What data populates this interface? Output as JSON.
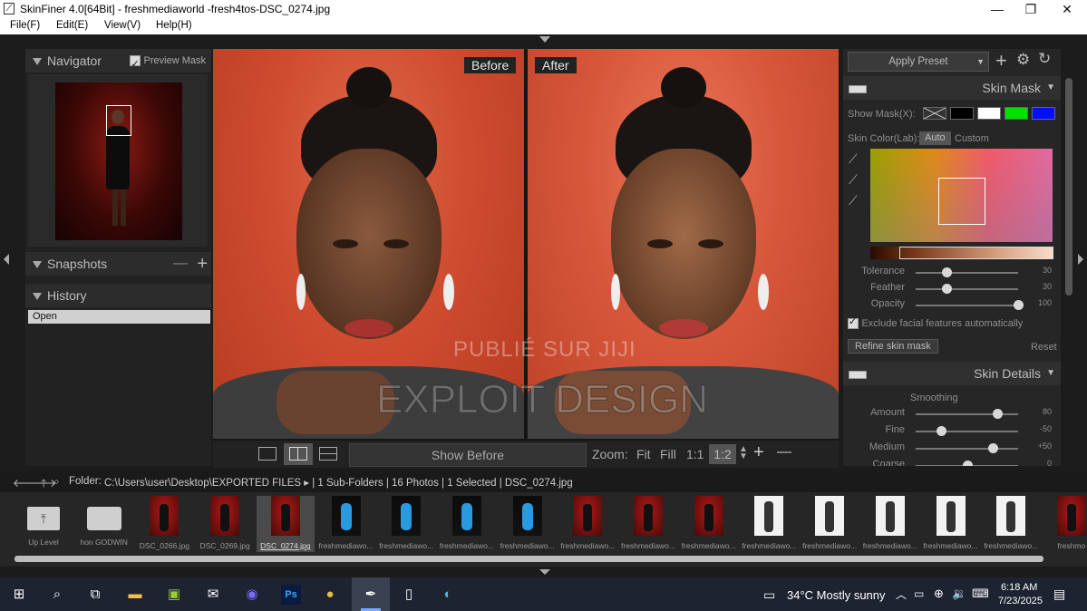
{
  "window": {
    "title": "SkinFiner 4.0[64Bit] - freshmediaworld -fresh4tos-DSC_0274.jpg",
    "controls": {
      "minimize": "—",
      "maximize": "❐",
      "close": "✕"
    }
  },
  "menu": [
    "File(F)",
    "Edit(E)",
    "View(V)",
    "Help(H)"
  ],
  "left": {
    "navigator": {
      "title": "Navigator",
      "preview_mask_label": "Preview Mask",
      "preview_mask_checked": true
    },
    "snapshots": {
      "title": "Snapshots",
      "minus": "—",
      "plus": "+"
    },
    "history": {
      "title": "History",
      "items": [
        "Open"
      ]
    }
  },
  "viewer": {
    "before_label": "Before",
    "after_label": "After",
    "watermark_top": "PUBLIÉ SUR JIJI",
    "watermark_main": "EXPLOIT DESIGN",
    "toolbar": {
      "show_before": "Show Before",
      "zoom_label": "Zoom:",
      "fit": "Fit",
      "fill": "Fill",
      "one_to_one": "1:1",
      "ratio": "1:2",
      "zoom_in": "+",
      "zoom_out": "—"
    }
  },
  "right": {
    "apply_preset": "Apply Preset",
    "skin_mask": {
      "title": "Skin Mask",
      "show_mask_label": "Show Mask(X):",
      "swatch_colors": [
        "#000000",
        "#ffffff",
        "#00e000",
        "#0010ff"
      ],
      "skin_color_label": "Skin Color(Lab):",
      "auto": "Auto",
      "custom": "Custom",
      "sliders": [
        {
          "label": "Tolerance",
          "value": "30",
          "pos": 0.3
        },
        {
          "label": "Feather",
          "value": "30",
          "pos": 0.3
        },
        {
          "label": "Opacity",
          "value": "100",
          "pos": 1.0
        }
      ],
      "exclude_label": "Exclude facial features automatically",
      "refine_button": "Refine skin mask",
      "reset": "Reset"
    },
    "skin_details": {
      "title": "Skin Details",
      "smoothing_label": "Smoothing",
      "sliders": [
        {
          "label": "Amount",
          "value": "80",
          "pos": 0.8
        },
        {
          "label": "Fine",
          "value": "-50",
          "pos": 0.25
        },
        {
          "label": "Medium",
          "value": "+50",
          "pos": 0.75
        },
        {
          "label": "Coarse",
          "value": "0",
          "pos": 0.5
        }
      ]
    }
  },
  "filebar": {
    "folder_label": "Folder:",
    "path_text": "C:\\Users\\user\\Desktop\\EXPORTED FILES ▸ | 1 Sub-Folders | 16 Photos | 1 Selected | DSC_0274.jpg"
  },
  "thumbnails": [
    {
      "caption": "Up Level",
      "kind": "up"
    },
    {
      "caption": "hon GODWIN",
      "kind": "folder"
    },
    {
      "caption": "DSC_0266.jpg",
      "kind": "red"
    },
    {
      "caption": "DSC_0269.jpg",
      "kind": "red"
    },
    {
      "caption": "DSC_0274.jpg",
      "kind": "red",
      "selected": true
    },
    {
      "caption": "freshmediawo...",
      "kind": "blue"
    },
    {
      "caption": "freshmediawo...",
      "kind": "blue"
    },
    {
      "caption": "freshmediawo...",
      "kind": "blue"
    },
    {
      "caption": "freshmediawo...",
      "kind": "blue"
    },
    {
      "caption": "freshmediawo...",
      "kind": "red"
    },
    {
      "caption": "freshmediawo...",
      "kind": "red"
    },
    {
      "caption": "freshmediawo...",
      "kind": "red"
    },
    {
      "caption": "freshmediawo...",
      "kind": "white"
    },
    {
      "caption": "freshmediawo...",
      "kind": "white"
    },
    {
      "caption": "freshmediawo...",
      "kind": "white"
    },
    {
      "caption": "freshmediawo...",
      "kind": "white"
    },
    {
      "caption": "freshmediawo...",
      "kind": "white"
    },
    {
      "caption": "freshmo",
      "kind": "red"
    }
  ],
  "taskbar": {
    "weather": "34°C  Mostly sunny",
    "time": "6:18 AM",
    "date": "7/23/2025",
    "ps_label": "Ps"
  }
}
